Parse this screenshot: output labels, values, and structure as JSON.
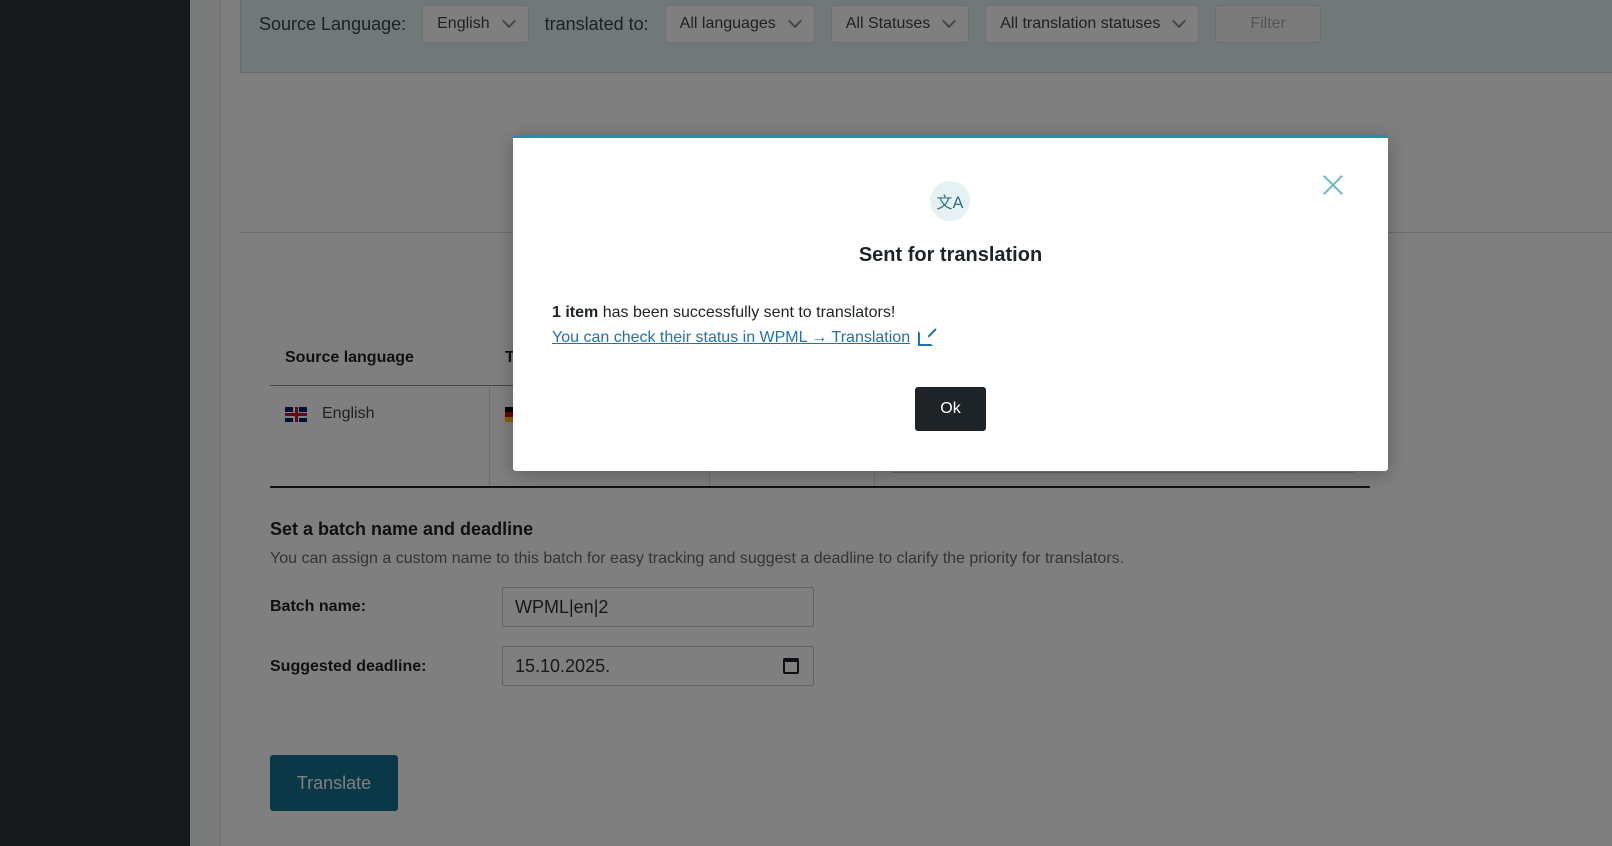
{
  "filters": {
    "source_label": "Source Language:",
    "source_value": "English",
    "translated_label": "translated to:",
    "languages_value": "All languages",
    "statuses_value": "All Statuses",
    "translation_statuses_value": "All translation statuses",
    "filter_button": "Filter"
  },
  "table": {
    "headers": [
      "Source language",
      "T"
    ],
    "rows": [
      {
        "source": "English"
      }
    ]
  },
  "batch": {
    "title": "Set a batch name and deadline",
    "description": "You can assign a custom name to this batch for easy tracking and suggest a deadline to clarify the priority for translators.",
    "name_label": "Batch name:",
    "name_value": "WPML|en|2",
    "deadline_label": "Suggested deadline:",
    "deadline_value": "15.10.2025.",
    "translate_button": "Translate"
  },
  "modal": {
    "icon": "translate-icon",
    "icon_glyph": "文A",
    "title": "Sent for translation",
    "message_bold": "1 item",
    "message_rest": " has been successfully sent to translators!",
    "link_text": "You can check their status in WPML → Translation",
    "ok_button": "Ok"
  },
  "colors": {
    "accent": "#16708e",
    "modal_border": "#33879e",
    "dark_button": "#1d2327"
  }
}
